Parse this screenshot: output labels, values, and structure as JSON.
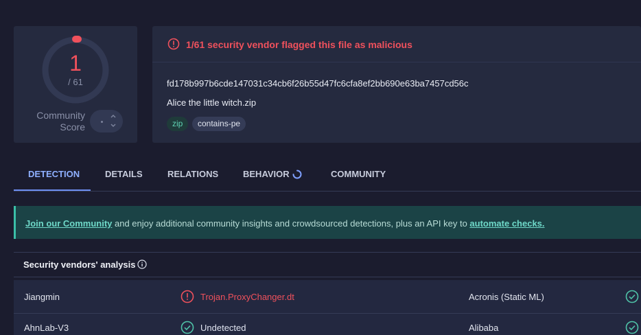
{
  "score": {
    "detections": "1",
    "total": "/ 61",
    "community_label": "Community\nScore"
  },
  "alert": {
    "text": "1/61 security vendor flagged this file as malicious"
  },
  "file": {
    "hash": "fd178b997b6cde147031c34cb6f26b55d47fc6cfa8ef2bb690e63ba7457cd56c",
    "name": "Alice the little witch.zip",
    "tags": [
      "zip",
      "contains-pe"
    ]
  },
  "tabs": [
    "DETECTION",
    "DETAILS",
    "RELATIONS",
    "BEHAVIOR",
    "COMMUNITY"
  ],
  "banner": {
    "link1": "Join our Community",
    "middle": " and enjoy additional community insights and crowdsourced detections, plus an API key to ",
    "link2": "automate checks."
  },
  "vendors": {
    "title": "Security vendors' analysis",
    "rows": [
      {
        "left_name": "Jiangmin",
        "left_result": "Trojan.ProxyChanger.dt",
        "right_name": "Acronis (Static ML)",
        "right_result": ""
      },
      {
        "left_name": "AhnLab-V3",
        "left_result": "Undetected",
        "right_name": "Alibaba",
        "right_result": ""
      }
    ]
  },
  "colors": {
    "malicious": "#f0515c",
    "accent": "#6e8ff2",
    "ok": "#4fc3a8"
  }
}
